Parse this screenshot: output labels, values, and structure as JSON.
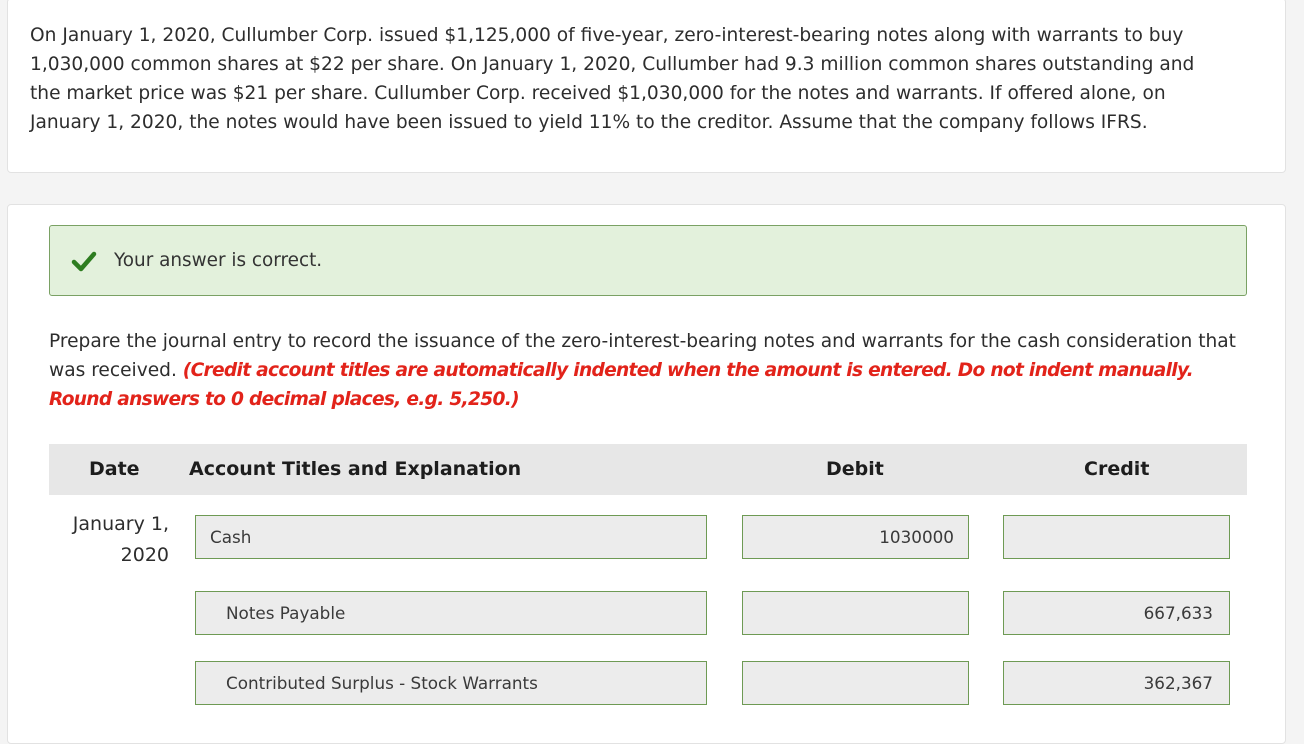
{
  "problem": {
    "text": "On January 1, 2020, Cullumber Corp. issued $1,125,000 of five-year, zero-interest-bearing notes along with warrants to buy 1,030,000 common shares at $22 per share. On January 1, 2020, Cullumber had 9.3 million common shares outstanding and the market price was $21 per share. Cullumber Corp. received $1,030,000 for the notes and warrants. If offered alone, on January 1, 2020, the notes would have been issued to yield 11% to the creditor. Assume that the company follows IFRS."
  },
  "feedback": {
    "icon": "check-icon",
    "message": "Your answer is correct."
  },
  "instructions": {
    "text": "Prepare the journal entry to record the issuance of the zero-interest-bearing notes and warrants for the cash consideration that was received.",
    "note": "(Credit account titles are automatically indented when the amount is entered. Do not indent manually. Round answers to 0 decimal places, e.g. 5,250.)"
  },
  "table": {
    "headers": {
      "date": "Date",
      "account": "Account Titles and Explanation",
      "debit": "Debit",
      "credit": "Credit"
    },
    "date_line1": "January 1,",
    "date_line2": "2020",
    "rows": [
      {
        "account": "Cash",
        "debit": "1030000",
        "credit": ""
      },
      {
        "account": "Notes Payable",
        "debit": "",
        "credit": "667,633"
      },
      {
        "account": "Contributed Surplus - Stock Warrants",
        "debit": "",
        "credit": "362,367"
      }
    ]
  },
  "colors": {
    "feedback_bg": "#e3f1dc",
    "feedback_border": "#7aa164",
    "check_green": "#2e7d20",
    "note_red": "#e2231a",
    "input_border": "#6e9a54",
    "input_bg": "#ececec"
  }
}
